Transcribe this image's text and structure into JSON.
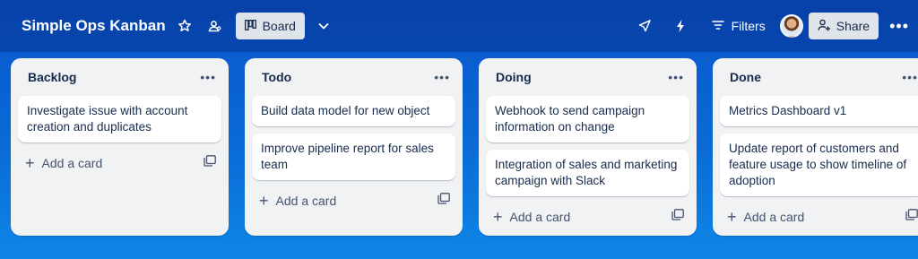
{
  "board": {
    "title": "Simple Ops Kanban",
    "view_label": "Board"
  },
  "toolbar": {
    "filters_label": "Filters",
    "share_label": "Share"
  },
  "icons": {
    "star": "star-icon",
    "workspace": "workspace-visibility-icon",
    "board_view": "board-view-icon",
    "chevron": "chevron-down-icon",
    "power_ups": "rocket-icon",
    "automation": "lightning-icon",
    "filter": "filter-icon",
    "share": "person-add-icon",
    "more": "more-horizontal-icon"
  },
  "lists": [
    {
      "title": "Backlog",
      "cards": [
        "Investigate issue with account creation and duplicates"
      ],
      "add_label": "Add a card"
    },
    {
      "title": "Todo",
      "cards": [
        "Build data model for new object",
        "Improve pipeline report for sales team"
      ],
      "add_label": "Add a card"
    },
    {
      "title": "Doing",
      "cards": [
        "Webhook to send campaign information on change",
        "Integration of sales and marketing campaign with Slack"
      ],
      "add_label": "Add a card"
    },
    {
      "title": "Done",
      "cards": [
        "Metrics Dashboard v1",
        "Update report of customers and feature usage to show timeline of adoption"
      ],
      "add_label": "Add a card"
    }
  ],
  "colors": {
    "header_bg": "#0b4fb8",
    "background": "#0a66d4",
    "list_bg": "#f1f2f4",
    "text": "#172b4d"
  }
}
